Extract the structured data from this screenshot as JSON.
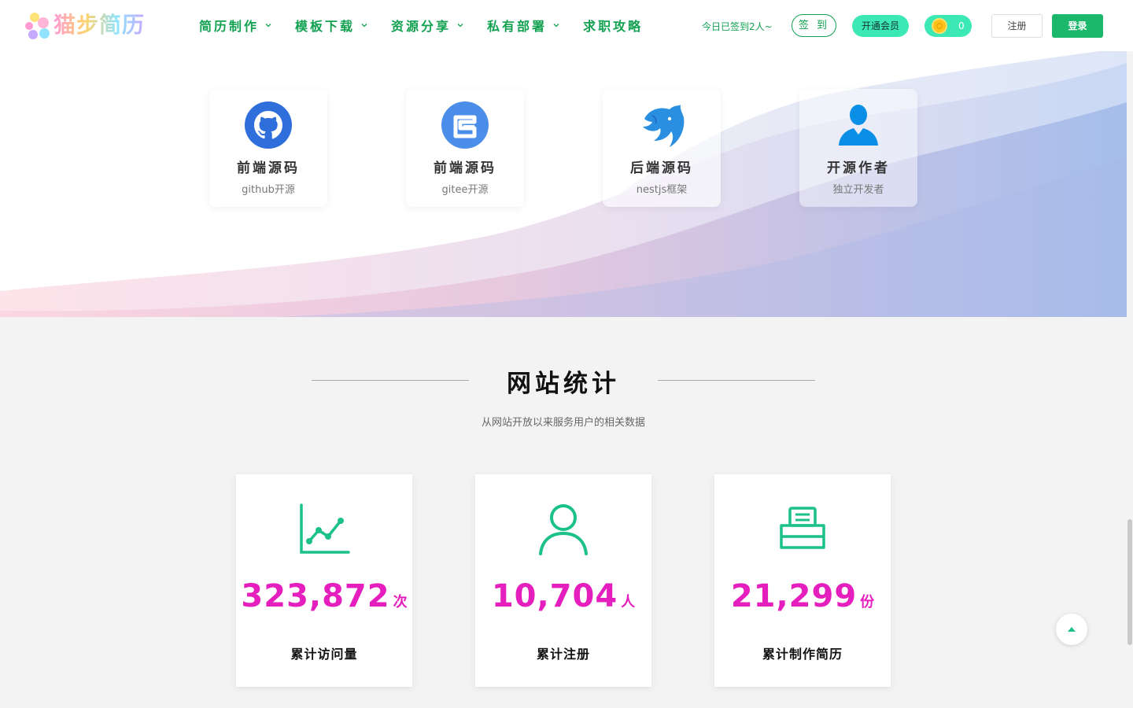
{
  "brand": {
    "name": "猫步简历"
  },
  "nav": {
    "items": [
      {
        "label": "简历制作",
        "has_dropdown": true
      },
      {
        "label": "模板下载",
        "has_dropdown": true
      },
      {
        "label": "资源分享",
        "has_dropdown": true
      },
      {
        "label": "私有部署",
        "has_dropdown": true
      },
      {
        "label": "求职攻略",
        "has_dropdown": false
      }
    ],
    "signin_note": "今日已签到2人~",
    "sign_label": "签 到",
    "vip_label": "开通会员",
    "coins": "0",
    "register_label": "注册",
    "login_label": "登录"
  },
  "source_cards": [
    {
      "title": "前端源码",
      "subtitle": "github开源",
      "icon": "github-icon"
    },
    {
      "title": "前端源码",
      "subtitle": "gitee开源",
      "icon": "gitee-icon"
    },
    {
      "title": "后端源码",
      "subtitle": "nestjs框架",
      "icon": "nestjs-icon"
    },
    {
      "title": "开源作者",
      "subtitle": "独立开发者",
      "icon": "user-icon"
    }
  ],
  "stats": {
    "title": "网站统计",
    "subtitle": "从网站开放以来服务用户的相关数据",
    "cards": [
      {
        "value": "323,872",
        "unit": "次",
        "label": "累计访问量",
        "icon": "line-chart-icon"
      },
      {
        "value": "10,704",
        "unit": "人",
        "label": "累计注册",
        "icon": "user-outline-icon"
      },
      {
        "value": "21,299",
        "unit": "份",
        "label": "累计制作简历",
        "icon": "printer-icon"
      }
    ]
  },
  "colors": {
    "accent": "#12a150",
    "number": "#e51fbd",
    "icon_green": "#1cc08a",
    "vip": "#3ce8b3"
  }
}
